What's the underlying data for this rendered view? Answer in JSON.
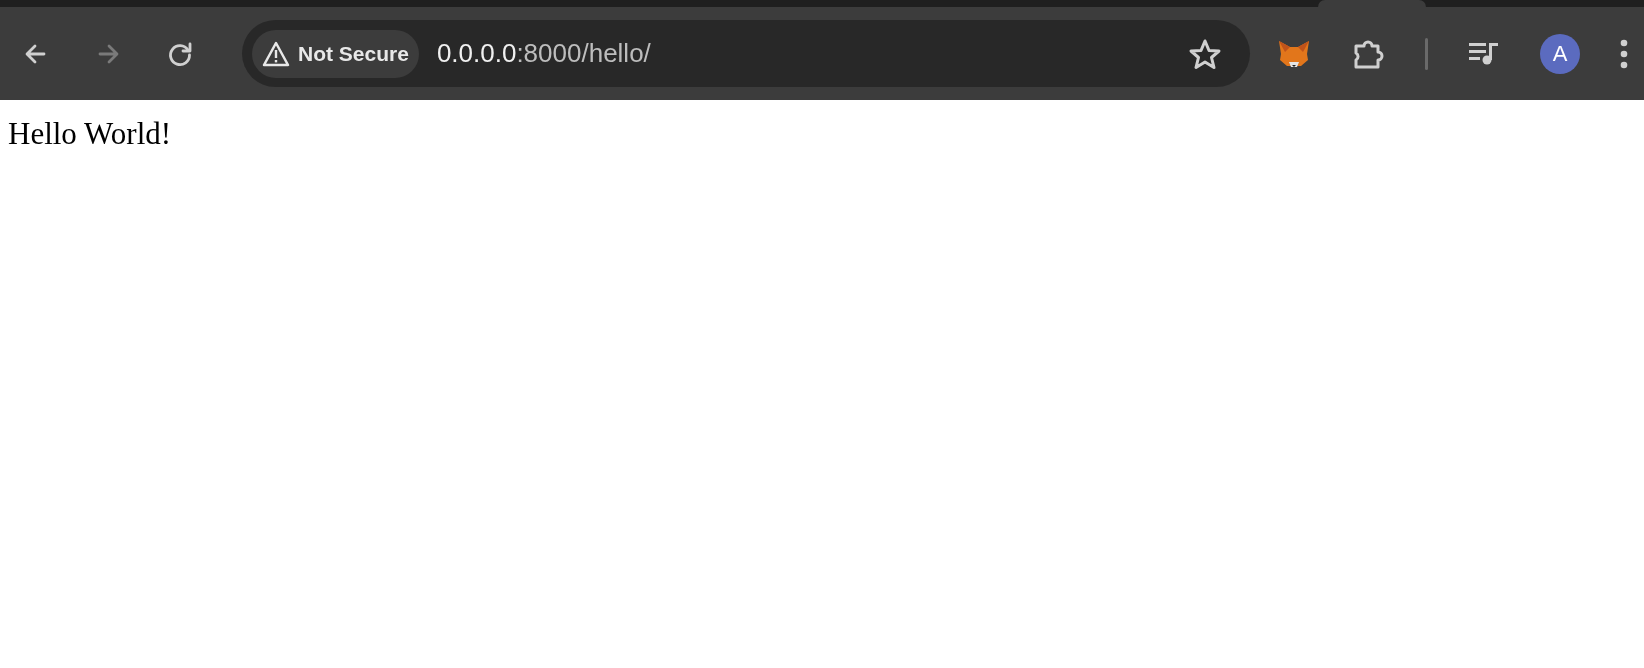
{
  "toolbar": {
    "nav_buttons": [
      {
        "kind": "back",
        "disabled": false
      },
      {
        "kind": "forward",
        "disabled": true
      },
      {
        "kind": "reload",
        "disabled": false
      }
    ],
    "address_bar": {
      "security_chip": "Not Secure",
      "url_host": "0.0.0.0",
      "url_path": ":8000/hello/"
    },
    "profile": {
      "initial": "A"
    }
  },
  "page": {
    "text": "Hello World!"
  }
}
